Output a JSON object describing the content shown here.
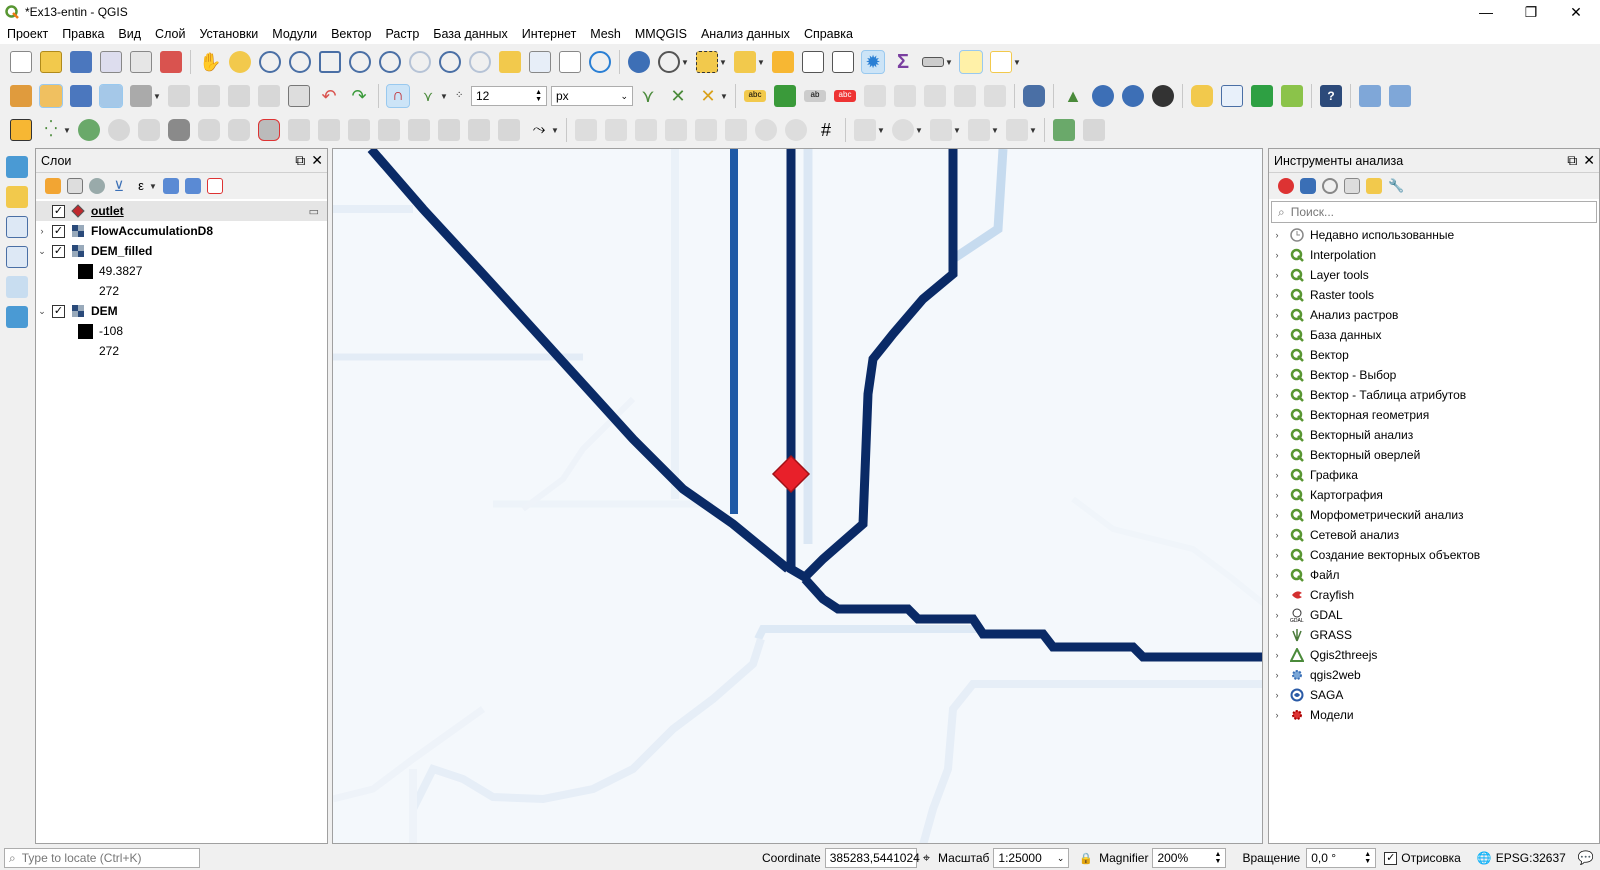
{
  "window": {
    "title": "*Ex13-entin - QGIS",
    "minimize": "—",
    "maximize": "❐",
    "close": "✕"
  },
  "menu": [
    "Проект",
    "Правка",
    "Вид",
    "Слой",
    "Установки",
    "Модули",
    "Вектор",
    "Растр",
    "База данных",
    "Интернет",
    "Mesh",
    "MMQGIS",
    "Анализ данных",
    "Справка"
  ],
  "toolbar": {
    "snap_tolerance": "12",
    "snap_units": "px"
  },
  "layers_panel": {
    "title": "Слои",
    "layers": [
      {
        "name": "outlet",
        "checked": true,
        "expandable": false
      },
      {
        "name": "FlowAccumulationD8",
        "checked": true,
        "expandable": true,
        "expanded": false
      },
      {
        "name": "DEM_filled",
        "checked": true,
        "expandable": true,
        "expanded": true,
        "legend": [
          "49.3827",
          "272"
        ]
      },
      {
        "name": "DEM",
        "checked": true,
        "expandable": true,
        "expanded": true,
        "legend": [
          "-108",
          "272"
        ]
      }
    ]
  },
  "toolbox": {
    "title": "Инструменты анализа",
    "search_placeholder": "Поиск...",
    "items": [
      {
        "label": "Недавно использованные",
        "icon": "clock-icon"
      },
      {
        "label": "Interpolation",
        "icon": "qgis-icon"
      },
      {
        "label": "Layer tools",
        "icon": "qgis-icon"
      },
      {
        "label": "Raster tools",
        "icon": "qgis-icon"
      },
      {
        "label": "Анализ растров",
        "icon": "qgis-icon"
      },
      {
        "label": "База данных",
        "icon": "qgis-icon"
      },
      {
        "label": "Вектор",
        "icon": "qgis-icon"
      },
      {
        "label": "Вектор - Выбор",
        "icon": "qgis-icon"
      },
      {
        "label": "Вектор - Таблица атрибутов",
        "icon": "qgis-icon"
      },
      {
        "label": "Векторная геометрия",
        "icon": "qgis-icon"
      },
      {
        "label": "Векторный анализ",
        "icon": "qgis-icon"
      },
      {
        "label": "Векторный оверлей",
        "icon": "qgis-icon"
      },
      {
        "label": "Графика",
        "icon": "qgis-icon"
      },
      {
        "label": "Картография",
        "icon": "qgis-icon"
      },
      {
        "label": "Морфометрический анализ",
        "icon": "qgis-icon"
      },
      {
        "label": "Сетевой анализ",
        "icon": "qgis-icon"
      },
      {
        "label": "Создание векторных объектов",
        "icon": "qgis-icon"
      },
      {
        "label": "Файл",
        "icon": "qgis-icon"
      },
      {
        "label": "Crayfish",
        "icon": "crayfish-icon"
      },
      {
        "label": "GDAL",
        "icon": "gdal-icon"
      },
      {
        "label": "GRASS",
        "icon": "grass-icon"
      },
      {
        "label": "Qgis2threejs",
        "icon": "triangle-icon"
      },
      {
        "label": "qgis2web",
        "icon": "gear-icon"
      },
      {
        "label": "SAGA",
        "icon": "saga-icon"
      },
      {
        "label": "Модели",
        "icon": "models-icon"
      }
    ]
  },
  "statusbar": {
    "locate_placeholder": "Type to locate (Ctrl+K)",
    "coordinate_label": "Coordinate",
    "coordinate_value": "385283,5441024",
    "scale_label": "Масштаб",
    "scale_value": "1:25000",
    "magnifier_label": "Magnifier",
    "magnifier_value": "200%",
    "rotation_label": "Вращение",
    "rotation_value": "0,0 °",
    "render_label": "Отрисовка",
    "crs": "EPSG:32637"
  },
  "colors": {
    "stream_dark": "#0a2a66",
    "stream_mid": "#1f5aa6",
    "stream_light": "#c6dbef",
    "background": "#f4f8fc",
    "outlet": "#e8202a"
  }
}
